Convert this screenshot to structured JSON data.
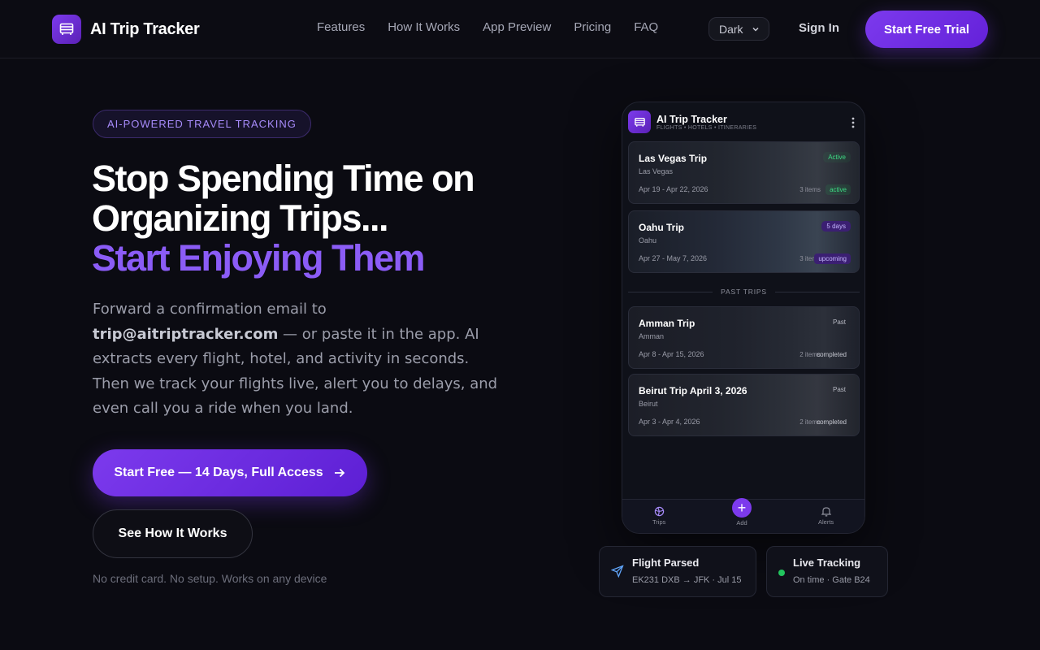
{
  "nav": {
    "brand": "AI Trip Tracker",
    "links": [
      "Features",
      "How It Works",
      "App Preview",
      "Pricing",
      "FAQ"
    ],
    "theme": "Dark",
    "signin": "Sign In",
    "trial": "Start Free Trial"
  },
  "hero": {
    "badge": "AI-POWERED TRAVEL TRACKING",
    "headline_1": "Stop Spending Time on",
    "headline_2": "Organizing Trips...",
    "headline_accent": "Start Enjoying Them",
    "sub_pre": "Forward a confirmation email to ",
    "sub_email": "trip@aitriptracker.com",
    "sub_post": " — or paste it in the app. AI extracts every flight, hotel, and activity in seconds. Then we track your flights live, alert you to delays, and even call you a ride when you land.",
    "cta_primary": "Start Free — 14 Days, Full Access",
    "cta_secondary": "See How It Works",
    "note": "No credit card. No setup. Works on any device"
  },
  "phone": {
    "title": "AI Trip Tracker",
    "subtitle": "FLIGHTS • HOTELS • ITINERARIES",
    "past_label": "PAST TRIPS",
    "trips": [
      {
        "name": "Las Vegas Trip",
        "place": "Las Vegas",
        "dates": "Apr 19 - Apr 22, 2026",
        "tag": "Active",
        "items": "3 items",
        "status": "active"
      },
      {
        "name": "Oahu Trip",
        "place": "Oahu",
        "dates": "Apr 27 - May 7, 2026",
        "tag": "5 days",
        "items": "3 items",
        "status": "upcoming"
      },
      {
        "name": "Amman Trip",
        "place": "Amman",
        "dates": "Apr 8 - Apr 15, 2026",
        "tag": "Past",
        "items": "2 items",
        "status": "completed"
      },
      {
        "name": "Beirut Trip April 3, 2026",
        "place": "Beirut",
        "dates": "Apr 3 - Apr 4, 2026",
        "tag": "Past",
        "items": "2 items",
        "status": "completed"
      }
    ],
    "tabs": {
      "trips": "Trips",
      "add": "Add",
      "alerts": "Alerts"
    }
  },
  "cards": {
    "flight_title": "Flight Parsed",
    "flight_sub": "EK231 DXB → JFK · Jul 15",
    "live_title": "Live Tracking",
    "live_sub": "On time · Gate B24"
  },
  "colors": {
    "accent": "#7c3aed",
    "accent_text": "#8b5cf6",
    "live": "#22c55e"
  }
}
